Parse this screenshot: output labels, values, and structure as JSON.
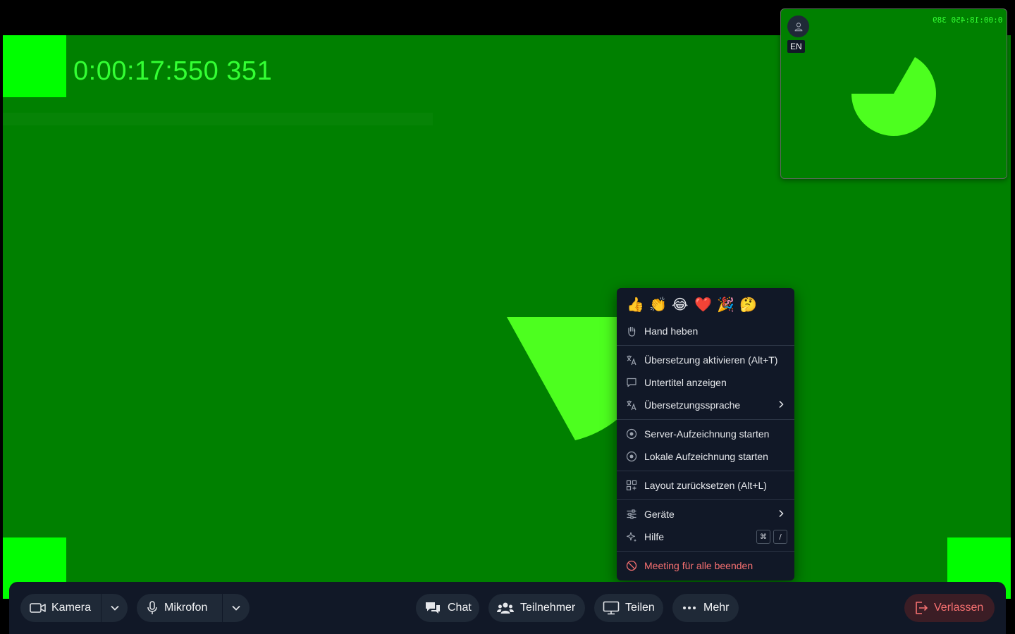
{
  "video": {
    "timestamp": "0:00:17:550 351",
    "background": "#008000",
    "accent": "#00ff00"
  },
  "pip": {
    "language_badge": "EN",
    "timestamp_mirrored": "0:00:18:450 389",
    "avatar_icon": "user-icon"
  },
  "menu": {
    "emojis": [
      "👍",
      "👏",
      "😂",
      "❤️",
      "🎉",
      "🤔"
    ],
    "hand_raise": "Hand heben",
    "translation_enable": "Übersetzung aktivieren (Alt+T)",
    "subtitles_show": "Untertitel anzeigen",
    "translation_language": "Übersetzungssprache",
    "server_recording": "Server-Aufzeichnung starten",
    "local_recording": "Lokale Aufzeichnung starten",
    "layout_reset": "Layout zurücksetzen (Alt+L)",
    "devices": "Geräte",
    "help": "Hilfe",
    "help_shortcut_keys": [
      "⌘",
      "/"
    ],
    "end_meeting": "Meeting für alle beenden"
  },
  "toolbar": {
    "camera": "Kamera",
    "microphone": "Mikrofon",
    "chat": "Chat",
    "participants": "Teilnehmer",
    "share": "Teilen",
    "more": "Mehr",
    "leave": "Verlassen"
  },
  "colors": {
    "menu_bg": "#111827",
    "danger": "#f87171"
  }
}
